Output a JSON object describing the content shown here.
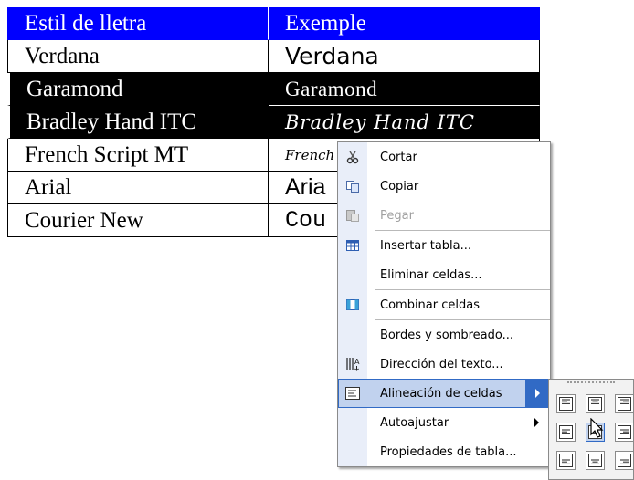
{
  "table": {
    "header": {
      "col1": "Estil de lletra",
      "col2": "Exemple"
    },
    "rows": [
      {
        "font": "Verdana",
        "sample": "Verdana"
      },
      {
        "font": "Garamond",
        "sample": "Garamond"
      },
      {
        "font": "Bradley Hand ITC",
        "sample": "Bradley Hand ITC"
      },
      {
        "font": "French Script MT",
        "sample": "French"
      },
      {
        "font": "Arial",
        "sample": "Aria"
      },
      {
        "font": "Courier New",
        "sample": "Cou"
      }
    ]
  },
  "context_menu": {
    "items": [
      {
        "label": "Cortar",
        "icon": "scissors-icon",
        "enabled": true
      },
      {
        "label": "Copiar",
        "icon": "copy-icon",
        "enabled": true
      },
      {
        "label": "Pegar",
        "icon": "paste-icon",
        "enabled": false
      },
      {
        "label": "Insertar tabla...",
        "icon": "insert-table-icon",
        "enabled": true
      },
      {
        "label": "Eliminar celdas...",
        "icon": "",
        "enabled": true
      },
      {
        "label": "Combinar celdas",
        "icon": "merge-cells-icon",
        "enabled": true
      },
      {
        "label": "Bordes y sombreado...",
        "icon": "",
        "enabled": true
      },
      {
        "label": "Dirección del texto...",
        "icon": "text-direction-icon",
        "enabled": true
      },
      {
        "label": "Alineación de celdas",
        "icon": "cell-alignment-icon",
        "enabled": true,
        "active": true,
        "submenu": true
      },
      {
        "label": "Autoajustar",
        "icon": "",
        "enabled": true,
        "submenu": true
      },
      {
        "label": "Propiedades de tabla...",
        "icon": "",
        "enabled": true
      }
    ]
  },
  "alignment_palette": {
    "options": [
      "top-left",
      "top-center",
      "top-right",
      "middle-left",
      "middle-center",
      "middle-right",
      "bottom-left",
      "bottom-center",
      "bottom-right"
    ],
    "hovered": "middle-center"
  },
  "colors": {
    "header_bg": "#0000ff",
    "selection_bg": "#000000",
    "menu_highlight": "#c1d2ee",
    "menu_highlight_border": "#316ac5",
    "menu_icon_strip": "#e9eef9"
  }
}
